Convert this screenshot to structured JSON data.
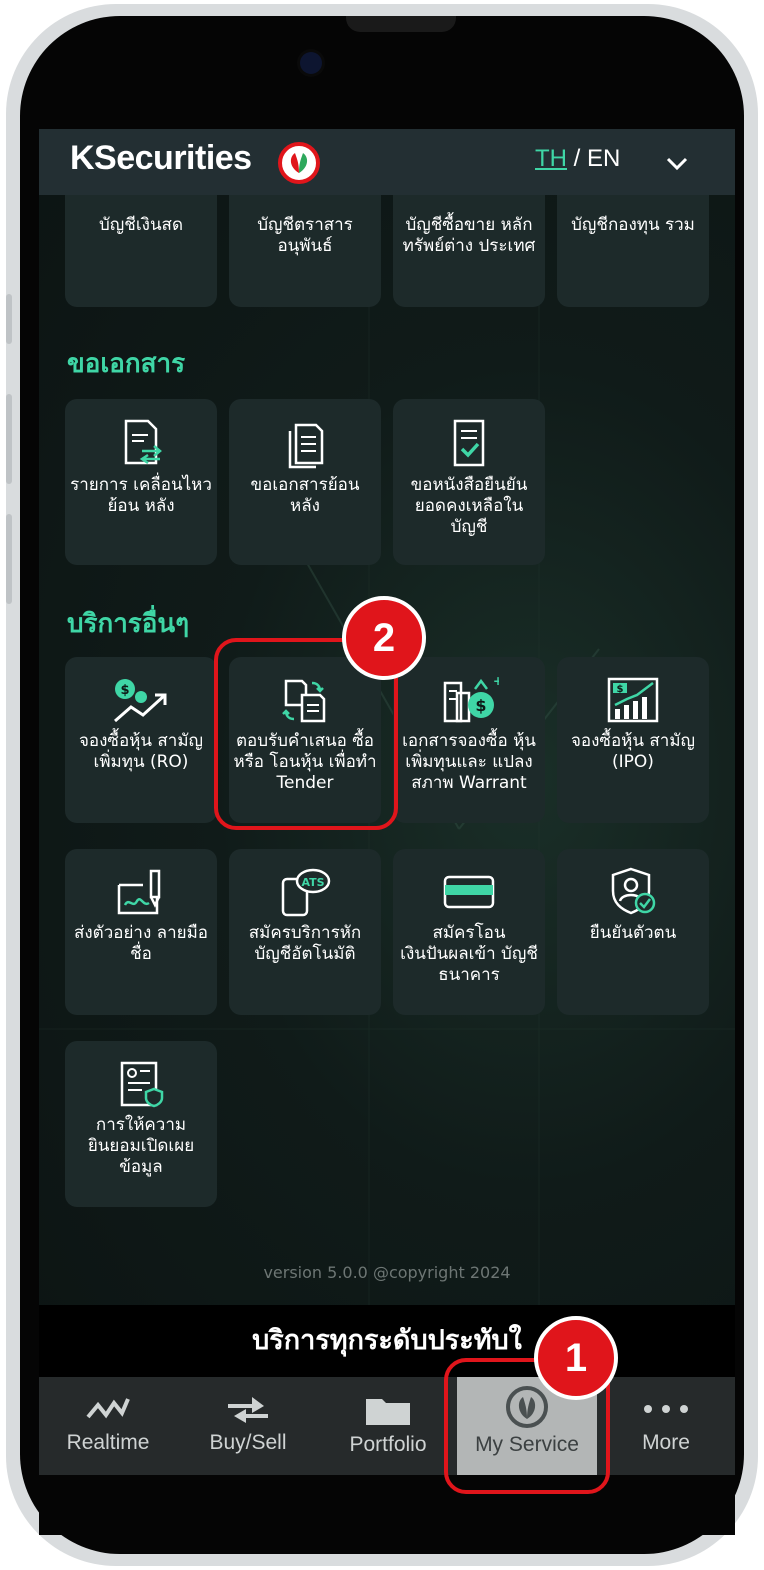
{
  "header": {
    "logo_text": "KSecurities",
    "lang_th": "TH",
    "lang_sep": " / ",
    "lang_en": "EN"
  },
  "top_tiles": [
    {
      "label": "บัญชีเงินสด"
    },
    {
      "label": "บัญชีตราสาร อนุพันธ์"
    },
    {
      "label": "บัญชีซื้อขาย หลักทรัพย์ต่าง ประเทศ"
    },
    {
      "label": "บัญชีกองทุน รวม"
    }
  ],
  "documents": {
    "title": "ขอเอกสาร",
    "tiles": [
      {
        "label": "รายการ เคลื่อนไหวย้อน หลัง",
        "icon": "transaction-doc-icon"
      },
      {
        "label": "ขอเอกสารย้อน หลัง",
        "icon": "documents-icon"
      },
      {
        "label": "ขอหนังสือยืนยัน ยอดคงเหลือใน บัญชี",
        "icon": "checked-doc-icon"
      }
    ]
  },
  "other_services": {
    "title": "บริการอื่นๆ",
    "tiles": [
      {
        "label": "จองซื้อหุ้น สามัญเพิ่มทุน (RO)",
        "icon": "rights-offering-icon"
      },
      {
        "label": "ตอบรับคำเสนอ ซื้อ หรือ โอนหุ้น เพื่อทำ Tender",
        "icon": "tender-offer-icon"
      },
      {
        "label": "เอกสารจองซื้อ หุ้นเพิ่มทุนและ แปลงสภาพ Warrant",
        "icon": "warrant-docs-icon"
      },
      {
        "label": "จองซื้อหุ้น สามัญ (IPO)",
        "icon": "ipo-chart-icon"
      },
      {
        "label": "ส่งตัวอย่าง ลายมือชื่อ",
        "icon": "signature-icon"
      },
      {
        "label": "สมัครบริการหัก บัญชีอัตโนมัติ",
        "icon": "ats-icon"
      },
      {
        "label": "สมัครโอน เงินปันผลเข้า บัญชีธนาคาร",
        "icon": "bank-card-icon"
      },
      {
        "label": "ยืนยันตัวตน",
        "icon": "identity-shield-icon"
      },
      {
        "label": "การให้ความ ยินยอมเปิดเผย ข้อมูล",
        "icon": "consent-doc-icon"
      }
    ]
  },
  "footer": {
    "version": "version 5.0.0 @copyright 2024"
  },
  "banner_text": "บริการทุกระดับประทับใ",
  "tabbar": {
    "tabs": [
      {
        "label": "Realtime",
        "icon": "realtime-chart-icon"
      },
      {
        "label": "Buy/Sell",
        "icon": "buy-sell-arrows-icon"
      },
      {
        "label": "Portfolio",
        "icon": "folder-icon"
      },
      {
        "label": "My Service",
        "icon": "kbank-leaf-icon",
        "active": true
      },
      {
        "label": "More",
        "icon": "more-dots-icon"
      }
    ]
  },
  "annotations": {
    "step1": "1",
    "step2": "2",
    "highlight_color": "#e0151b"
  },
  "colors": {
    "accent": "#3fd6a6",
    "tile_bg": "#1d2a2a",
    "header_bg": "#232f33"
  }
}
